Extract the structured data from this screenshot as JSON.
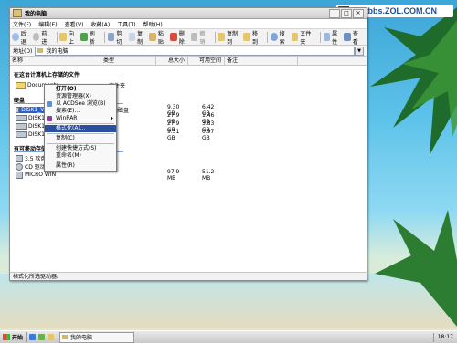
{
  "watermark": "Softbbs.ZOL.COM.CN",
  "window": {
    "title": "我的电脑",
    "menu": [
      "文件(F)",
      "编辑(E)",
      "查看(V)",
      "收藏(A)",
      "工具(T)",
      "帮助(H)"
    ],
    "toolbar": [
      "后退",
      "前进",
      "向上",
      "刷新",
      "剪切",
      "复制",
      "粘贴",
      "删除",
      "撤销",
      "复制到",
      "移到",
      "搜索",
      "文件夹",
      "属性",
      "查看"
    ],
    "address_label": "地址(D)",
    "address_value": "我的电脑",
    "columns": [
      "名称",
      "类型",
      "总大小",
      "可用空间",
      "备注"
    ],
    "groups": {
      "stored": "在这台计算机上存储的文件",
      "hdd": "硬盘",
      "removable": "有可移动存储的设备"
    },
    "files_rows": [
      {
        "name": "Documents",
        "type": "文件夹"
      }
    ],
    "disk_rows": [
      {
        "name": "DISK1_VOL1(C:)",
        "type": "本地磁盘",
        "total": "9.30 GB",
        "free": "6.42 GB"
      },
      {
        "name": "DISK1_VOL2",
        "type": "",
        "total": "27.9 GB",
        "free": "1.46 GB"
      },
      {
        "name": "DISK1_VOL3",
        "type": "",
        "total": "27.9 GB",
        "free": "3.83 GB"
      },
      {
        "name": "DISK1_VOL4",
        "type": "",
        "total": "9.31 GB",
        "free": "0.97 GB"
      }
    ],
    "removable_rows": [
      {
        "name": "3.5 软盘",
        "total": "",
        "free": ""
      },
      {
        "name": "CD 驱动器",
        "total": "",
        "free": ""
      },
      {
        "name": "MICRO WIN",
        "total": "97.9 MB",
        "free": "51.2 MB"
      }
    ],
    "status": "格式化所选驱动器。"
  },
  "context_menu": [
    {
      "label": "打开(O)",
      "bold": true
    },
    {
      "label": "资源管理器(X)"
    },
    {
      "label": "以 ACDSee 浏览(B)"
    },
    {
      "label": "搜索(E)..."
    },
    {
      "label": "WinRAR",
      "submenu": true
    },
    {
      "sep": true
    },
    {
      "label": "格式化(A)...",
      "highlight": true
    },
    {
      "sep": true
    },
    {
      "label": "复制(C)"
    },
    {
      "sep": true
    },
    {
      "label": "创建快捷方式(S)"
    },
    {
      "label": "重命名(M)"
    },
    {
      "sep": true
    },
    {
      "label": "属性(R)"
    }
  ],
  "taskbar": {
    "start": "开始",
    "task": "我的电脑",
    "clock": "18:17"
  },
  "colors": {
    "selection": "#2a62c9",
    "menu_highlight": "#2a4f9f"
  }
}
